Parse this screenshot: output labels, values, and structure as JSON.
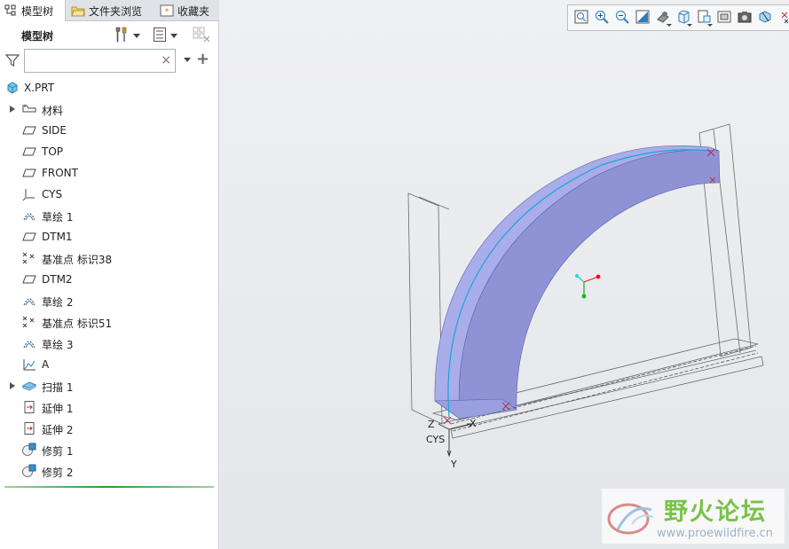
{
  "tabs": [
    {
      "label": "模型树",
      "active": true
    },
    {
      "label": "文件夹浏览",
      "active": false
    },
    {
      "label": "收藏夹",
      "active": false
    }
  ],
  "tree_header": {
    "title": "模型树"
  },
  "search": {
    "value": "",
    "placeholder": "",
    "clear": "×",
    "add": "+"
  },
  "tree": {
    "root": {
      "label": "X.PRT",
      "icon": "part-icon"
    },
    "items": [
      {
        "label": "材料",
        "icon": "material-icon",
        "expandable": true
      },
      {
        "label": "SIDE",
        "icon": "datum-plane-icon"
      },
      {
        "label": "TOP",
        "icon": "datum-plane-icon"
      },
      {
        "label": "FRONT",
        "icon": "datum-plane-icon"
      },
      {
        "label": "CYS",
        "icon": "coordinate-system-icon"
      },
      {
        "label": "草绘 1",
        "icon": "sketch-icon"
      },
      {
        "label": "DTM1",
        "icon": "datum-plane-icon"
      },
      {
        "label": "基准点 标识38",
        "icon": "datum-point-icon"
      },
      {
        "label": "DTM2",
        "icon": "datum-plane-icon"
      },
      {
        "label": "草绘 2",
        "icon": "sketch-icon"
      },
      {
        "label": "基准点 标识51",
        "icon": "datum-point-icon"
      },
      {
        "label": "草绘 3",
        "icon": "sketch-icon"
      },
      {
        "label": "A",
        "icon": "graph-icon"
      },
      {
        "label": "扫描 1",
        "icon": "sweep-icon",
        "expandable": true
      },
      {
        "label": "延伸 1",
        "icon": "extend-icon"
      },
      {
        "label": "延伸 2",
        "icon": "extend-icon"
      },
      {
        "label": "修剪 1",
        "icon": "trim-icon"
      },
      {
        "label": "修剪 2",
        "icon": "trim-icon"
      }
    ]
  },
  "view_toolbar": [
    "refit-icon",
    "zoom-in-icon",
    "zoom-out-icon",
    "repaint-icon",
    "display-style-icon",
    "saved-views-icon",
    "view-manager-icon",
    "perspective-icon",
    "camera-icon",
    "section-icon",
    "datum-display-icon"
  ],
  "scene": {
    "csys_label": "CYS",
    "axis_x": "X",
    "axis_y": "Y",
    "axis_z": "Z",
    "part_color": "#8f93d6",
    "edge_color": "#15a6d6"
  },
  "watermark": {
    "name": "野火论坛",
    "url": "www.proewildfire.cn"
  }
}
